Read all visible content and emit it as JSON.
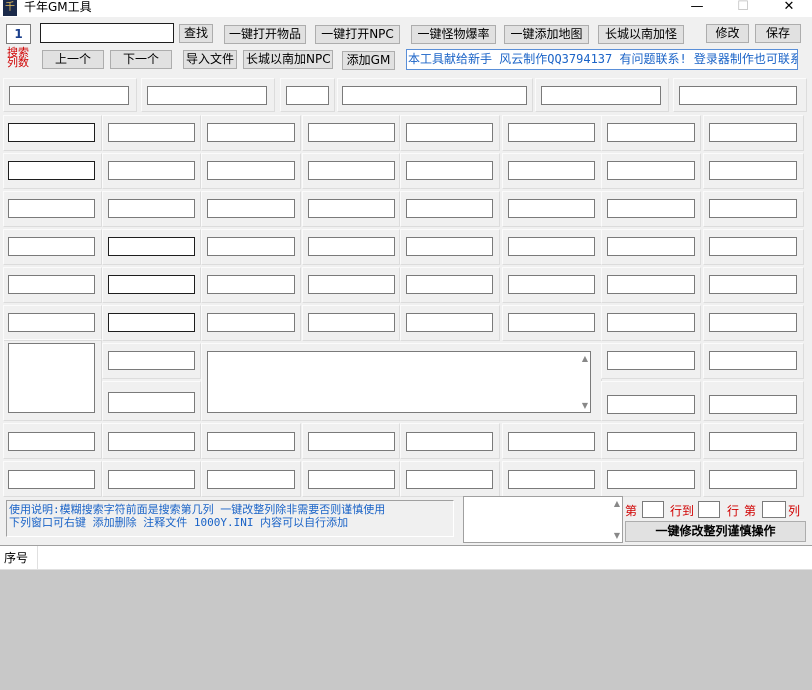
{
  "window": {
    "title": "千年GM工具",
    "minimize": "—",
    "maximize": "☐",
    "close": "✕"
  },
  "toolbar": {
    "column_number_value": "1",
    "search_input_value": "",
    "search_button": "查找",
    "open_items_button": "一键打开物品",
    "open_npc_button": "一键打开NPC",
    "monster_drop_button": "一键怪物爆率",
    "add_map_button": "一键添加地图",
    "south_great_wall_monster_button": "长城以南加怪",
    "modify_button": "修改",
    "save_button": "保存",
    "search_col_label_1": "搜索",
    "search_col_label_2": "列数",
    "prev_button": "上一个",
    "next_button": "下一个",
    "import_file_button": "导入文件",
    "south_great_wall_npc_button": "长城以南加NPC",
    "add_gm_button": "添加GM",
    "info_banner": "本工具献给新手 风云制作QQ3794137 有问题联系! 登录器制作也可联系!"
  },
  "instructions": {
    "line1": "使用说明:模糊搜索字符前面是搜索第几列 一键改整列除非需要否则谨慎使用",
    "line2": "下列窗口可右键 添加删除 注释文件 1000Y.INI 内容可以自行添加"
  },
  "batch_edit": {
    "label_di_1": "第",
    "label_row_to": "行到",
    "label_row": "行",
    "label_di_2": "第",
    "label_col": "列",
    "from_value": "",
    "to_value": "",
    "col_value": "",
    "apply_button": "一键修改整列谨慎操作"
  },
  "table": {
    "columns": [
      "序号"
    ]
  },
  "colors": {
    "accent_blue": "#1a63c7",
    "label_red": "#d00000"
  }
}
